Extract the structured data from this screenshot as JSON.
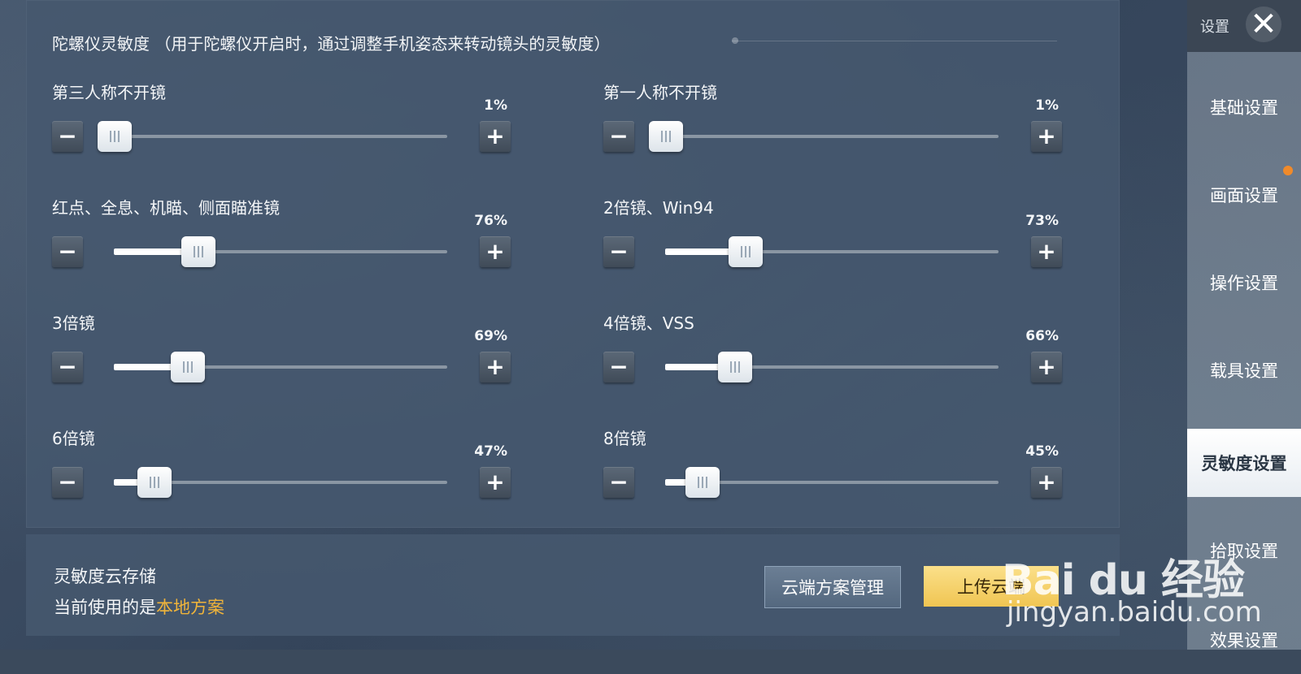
{
  "header": {
    "section_title": "陀螺仪灵敏度 （用于陀螺仪开启时，通过调整手机姿态来转动镜头的灵敏度）"
  },
  "settings": [
    {
      "label": "第三人称不开镜",
      "value_text": "1%",
      "value": 1
    },
    {
      "label": "第一人称不开镜",
      "value_text": "1%",
      "value": 1
    },
    {
      "label": "红点、全息、机瞄、侧面瞄准镜",
      "value_text": "76%",
      "value": 76
    },
    {
      "label": "2倍镜、Win94",
      "value_text": "73%",
      "value": 73
    },
    {
      "label": "3倍镜",
      "value_text": "69%",
      "value": 69
    },
    {
      "label": "4倍镜、VSS",
      "value_text": "66%",
      "value": 66
    },
    {
      "label": "6倍镜",
      "value_text": "47%",
      "value": 47
    },
    {
      "label": "8倍镜",
      "value_text": "45%",
      "value": 45
    }
  ],
  "controls": {
    "minus_symbol": "−",
    "plus_symbol": "+"
  },
  "sidebar": {
    "tag": "设置",
    "close_symbol": "✕",
    "items": [
      {
        "label": "基础设置"
      },
      {
        "label": "画面设置"
      },
      {
        "label": "操作设置"
      },
      {
        "label": "载具设置"
      },
      {
        "label": "灵敏度设置"
      },
      {
        "label": "拾取设置"
      },
      {
        "label": "效果设置"
      }
    ],
    "active_index": 4,
    "notification_dot_color": "#f08a2a"
  },
  "cloud": {
    "title": "灵敏度云存储",
    "status_prefix": "当前使用的是",
    "status_highlight": "本地方案",
    "manage_button": "云端方案管理",
    "upload_button": "上传云端"
  },
  "watermark": {
    "logo": "Bai du 经验",
    "url": "jingyan.baidu.com"
  }
}
